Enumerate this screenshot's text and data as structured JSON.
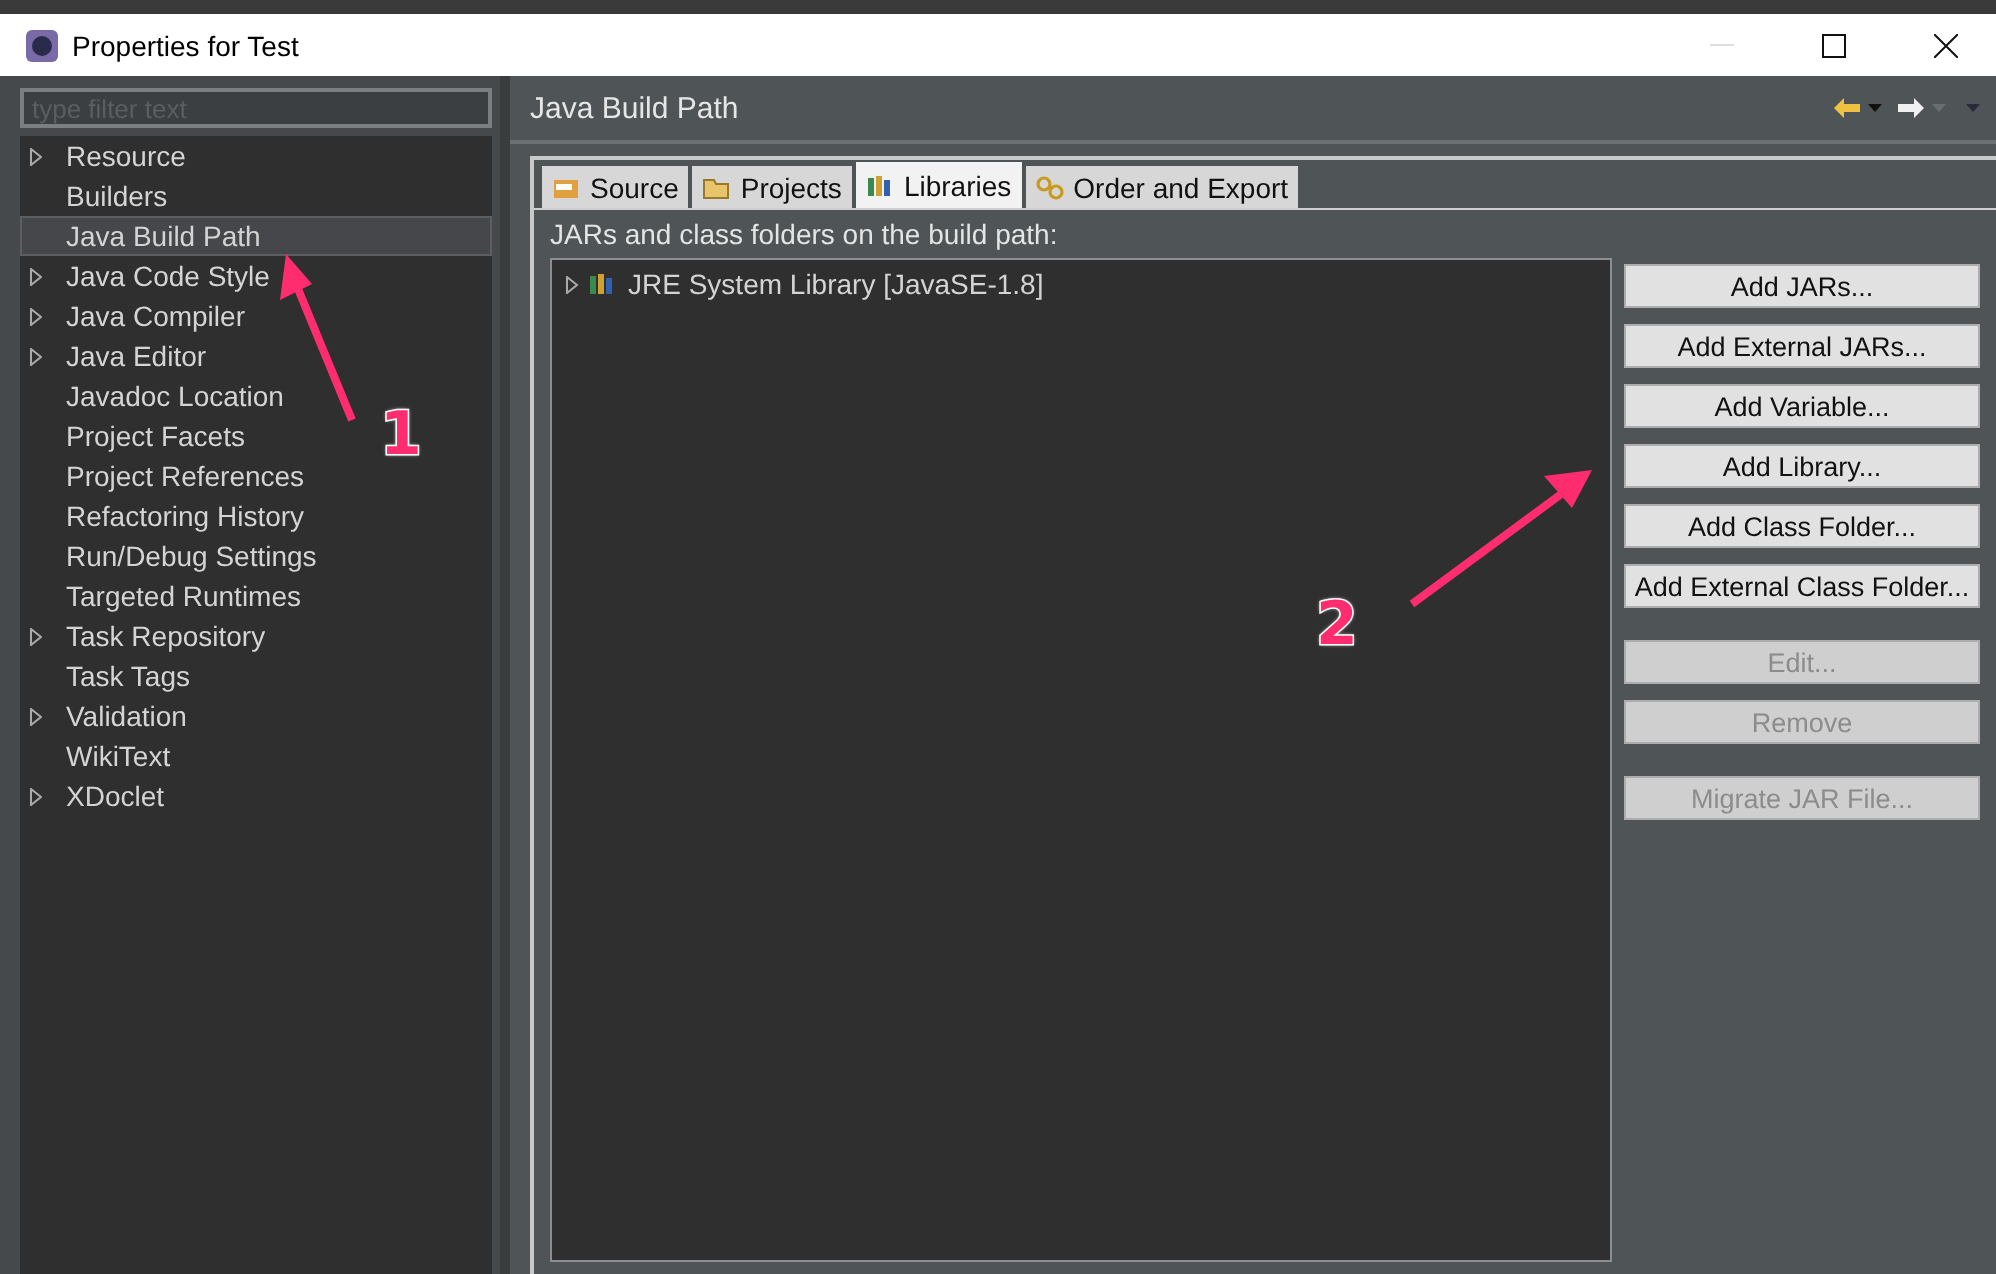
{
  "window": {
    "title": "Properties for Test"
  },
  "filter": {
    "placeholder": "type filter text"
  },
  "tree": [
    {
      "label": "Resource",
      "expandable": true,
      "selected": false
    },
    {
      "label": "Builders",
      "expandable": false,
      "selected": false
    },
    {
      "label": "Java Build Path",
      "expandable": false,
      "selected": true
    },
    {
      "label": "Java Code Style",
      "expandable": true,
      "selected": false
    },
    {
      "label": "Java Compiler",
      "expandable": true,
      "selected": false
    },
    {
      "label": "Java Editor",
      "expandable": true,
      "selected": false
    },
    {
      "label": "Javadoc Location",
      "expandable": false,
      "selected": false
    },
    {
      "label": "Project Facets",
      "expandable": false,
      "selected": false
    },
    {
      "label": "Project References",
      "expandable": false,
      "selected": false
    },
    {
      "label": "Refactoring History",
      "expandable": false,
      "selected": false
    },
    {
      "label": "Run/Debug Settings",
      "expandable": false,
      "selected": false
    },
    {
      "label": "Targeted Runtimes",
      "expandable": false,
      "selected": false
    },
    {
      "label": "Task Repository",
      "expandable": true,
      "selected": false
    },
    {
      "label": "Task Tags",
      "expandable": false,
      "selected": false
    },
    {
      "label": "Validation",
      "expandable": true,
      "selected": false
    },
    {
      "label": "WikiText",
      "expandable": false,
      "selected": false
    },
    {
      "label": "XDoclet",
      "expandable": true,
      "selected": false
    }
  ],
  "page": {
    "title": "Java Build Path"
  },
  "tabs": [
    {
      "label": "Source",
      "kind": "source",
      "selected": false
    },
    {
      "label": "Projects",
      "kind": "projects",
      "selected": false
    },
    {
      "label": "Libraries",
      "kind": "libraries",
      "selected": true
    },
    {
      "label": "Order and Export",
      "kind": "order",
      "selected": false
    }
  ],
  "libraries": {
    "caption": "JARs and class folders on the build path:",
    "items": [
      {
        "label": "JRE System Library [JavaSE-1.8]",
        "expanded": false
      }
    ]
  },
  "button_groups": [
    [
      {
        "label": "Add JARs...",
        "disabled": false
      },
      {
        "label": "Add External JARs...",
        "disabled": false
      },
      {
        "label": "Add Variable...",
        "disabled": false
      },
      {
        "label": "Add Library...",
        "disabled": false
      },
      {
        "label": "Add Class Folder...",
        "disabled": false
      },
      {
        "label": "Add External Class Folder...",
        "disabled": false
      }
    ],
    [
      {
        "label": "Edit...",
        "disabled": true
      },
      {
        "label": "Remove",
        "disabled": true
      }
    ],
    [
      {
        "label": "Migrate JAR File...",
        "disabled": true
      }
    ]
  ],
  "annotations": [
    {
      "number": "1"
    },
    {
      "number": "2"
    }
  ]
}
